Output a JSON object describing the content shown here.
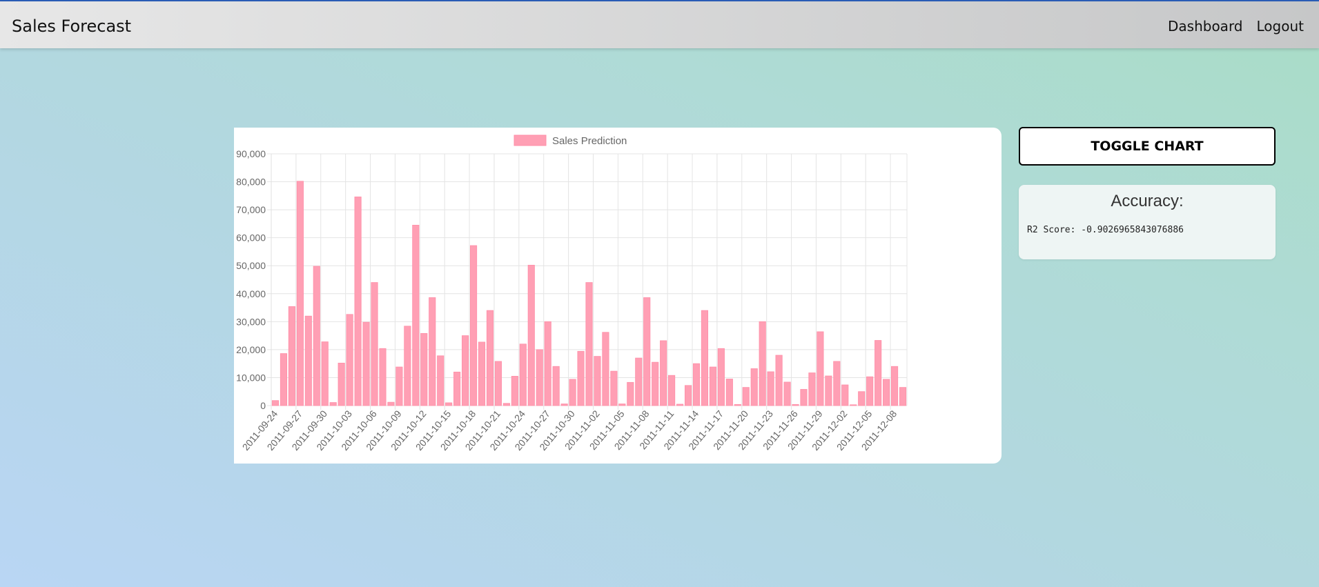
{
  "navbar": {
    "brand": "Sales Forecast",
    "links": [
      "Dashboard",
      "Logout"
    ]
  },
  "toggle": {
    "label": "TOGGLE CHART"
  },
  "accuracy": {
    "title": "Accuracy:",
    "score": "R2 Score: -0.9026965843076886"
  },
  "colors": {
    "bar_fill": "#ff9fb4",
    "bar_stroke": "#ff8fa8"
  },
  "chart_data": {
    "type": "bar",
    "legend": "Sales Prediction",
    "legend_position": "top",
    "grid": true,
    "ylim": [
      0,
      90000
    ],
    "yticks": [
      "0",
      "10,000",
      "20,000",
      "30,000",
      "40,000",
      "50,000",
      "60,000",
      "70,000",
      "80,000",
      "90,000"
    ],
    "xtick_labels": [
      "2011-09-24",
      "2011-09-27",
      "2011-09-30",
      "2011-10-03",
      "2011-10-06",
      "2011-10-09",
      "2011-10-12",
      "2011-10-15",
      "2011-10-18",
      "2011-10-21",
      "2011-10-24",
      "2011-10-27",
      "2011-10-30",
      "2011-11-02",
      "2011-11-05",
      "2011-11-08",
      "2011-11-11",
      "2011-11-14",
      "2011-11-17",
      "2011-11-20",
      "2011-11-23",
      "2011-11-26",
      "2011-11-29",
      "2011-12-02",
      "2011-12-05",
      "2011-12-08"
    ],
    "values": [
      1800,
      18600,
      35400,
      80200,
      32000,
      49800,
      22800,
      1100,
      15200,
      32600,
      74600,
      29800,
      44000,
      20400,
      1200,
      13800,
      28400,
      64500,
      25800,
      38600,
      17800,
      1000,
      12000,
      25000,
      57200,
      22700,
      34000,
      15800,
      800,
      10500,
      22000,
      50200,
      20000,
      30000,
      14000,
      600,
      9400,
      19400,
      44000,
      17600,
      26200,
      12300,
      600,
      8300,
      17000,
      38600,
      15500,
      23200,
      10800,
      500,
      7200,
      15000,
      34000,
      13800,
      20400,
      9500,
      400,
      6500,
      13200,
      30000,
      12100,
      18000,
      8400,
      400,
      5800,
      11700,
      26400,
      10600,
      15800,
      7400,
      300,
      5000,
      10300,
      23300,
      9400,
      14000,
      6500
    ]
  }
}
